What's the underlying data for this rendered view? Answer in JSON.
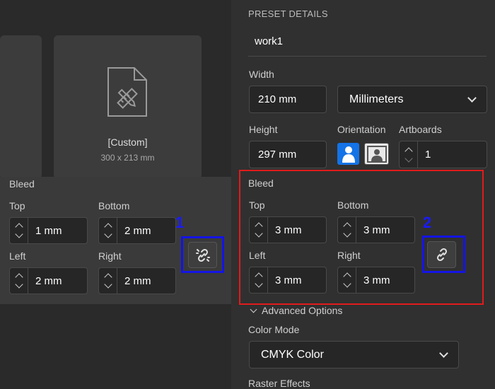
{
  "left": {
    "custom_card": {
      "name": "[Custom]",
      "size": "300 x 213 mm"
    },
    "bleed": {
      "title": "Bleed",
      "top_label": "Top",
      "top_value": "1 mm",
      "bottom_label": "Bottom",
      "bottom_value": "2 mm",
      "left_label": "Left",
      "left_value": "2 mm",
      "right_label": "Right",
      "right_value": "2 mm"
    },
    "marker": "1"
  },
  "right": {
    "preset_title": "PRESET DETAILS",
    "preset_name": "work1",
    "width_label": "Width",
    "width_value": "210 mm",
    "units_value": "Millimeters",
    "height_label": "Height",
    "height_value": "297 mm",
    "orientation_label": "Orientation",
    "artboards_label": "Artboards",
    "artboards_value": "1",
    "bleed": {
      "title": "Bleed",
      "top_label": "Top",
      "top_value": "3 mm",
      "bottom_label": "Bottom",
      "bottom_value": "3 mm",
      "left_label": "Left",
      "left_value": "3 mm",
      "right_label": "Right",
      "right_value": "3 mm"
    },
    "marker": "2",
    "advanced_label": "Advanced Options",
    "color_mode_label": "Color Mode",
    "color_mode_value": "CMYK Color",
    "raster_label": "Raster Effects"
  },
  "colors": {
    "accent": "#1473e6",
    "highlight_red": "#e21b1b",
    "highlight_blue": "#1414e6"
  }
}
